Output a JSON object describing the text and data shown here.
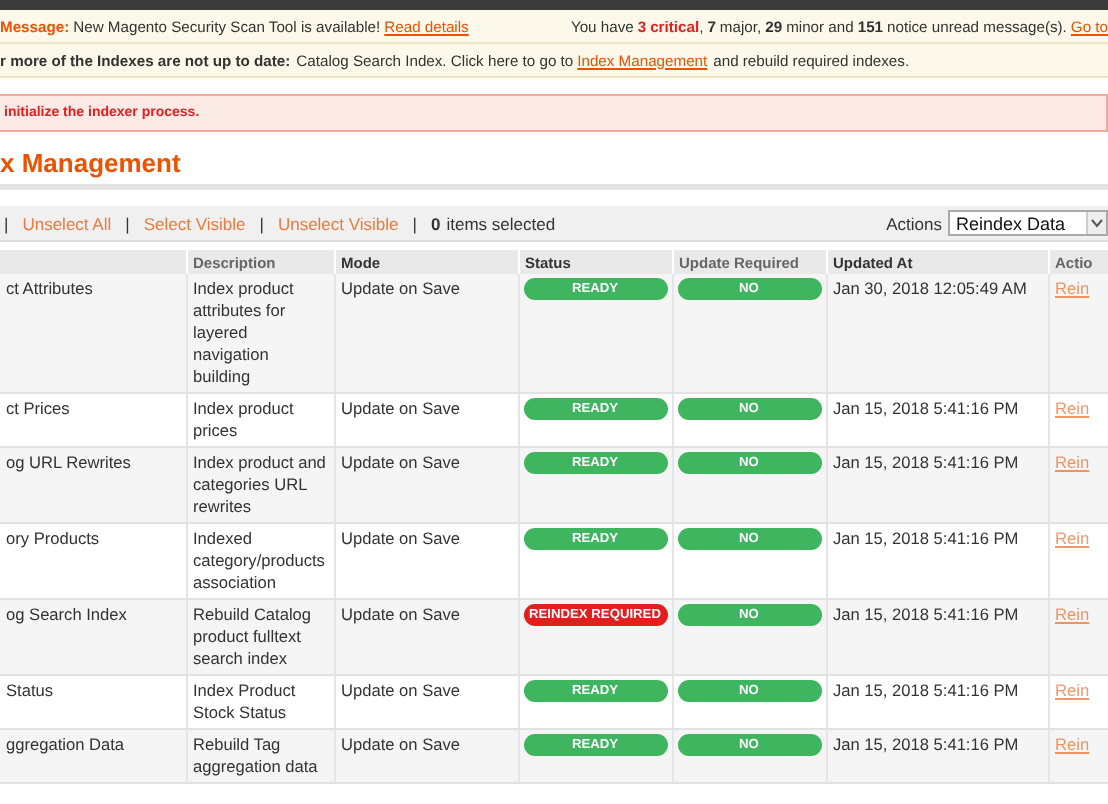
{
  "messages": {
    "system": {
      "label": "Message:",
      "text": "New Magento Security Scan Tool is available!",
      "link": "Read details"
    },
    "counts": {
      "prefix": "You have",
      "critical": "3",
      "critical_label": "critical",
      "critical_separator": ",",
      "major": "7",
      "major_label": "major,",
      "minor": "29",
      "minor_label": "minor and",
      "notice": "151",
      "notice_label": "notice unread message(s).",
      "link": "Go to"
    },
    "index_notice": {
      "label": "r more of the Indexes are not up to date:",
      "text": "Catalog Search Index. Click here to go to",
      "link": "Index Management",
      "suffix": "and rebuild required indexes."
    }
  },
  "error": "initialize the indexer process.",
  "page_title": "x Management",
  "toolbar": {
    "separator": "|",
    "links": [
      "Unselect All",
      "Select Visible",
      "Unselect Visible"
    ],
    "count": "0",
    "count_label": "items selected",
    "actions_label": "Actions",
    "actions_value": "Reindex Data"
  },
  "table": {
    "columns": [
      "",
      "Description",
      "Mode",
      "Status",
      "Update Required",
      "Updated At",
      "Actio"
    ],
    "rows": [
      {
        "name": "ct Attributes",
        "description": "Index product attributes for layered navigation building",
        "mode": "Update on Save",
        "status": {
          "kind": "ready",
          "label": "READY"
        },
        "update_required": "NO",
        "updated_at": "Jan 30, 2018 12:05:49 AM",
        "action": "Rein"
      },
      {
        "name": "ct Prices",
        "description": "Index product prices",
        "mode": "Update on Save",
        "status": {
          "kind": "ready",
          "label": "READY"
        },
        "update_required": "NO",
        "updated_at": "Jan 15, 2018 5:41:16 PM",
        "action": "Rein"
      },
      {
        "name": "og URL Rewrites",
        "description": "Index product and categories URL rewrites",
        "mode": "Update on Save",
        "status": {
          "kind": "ready",
          "label": "READY"
        },
        "update_required": "NO",
        "updated_at": "Jan 15, 2018 5:41:16 PM",
        "action": "Rein"
      },
      {
        "name": "ory Products",
        "description": "Indexed category/products association",
        "mode": "Update on Save",
        "status": {
          "kind": "ready",
          "label": "READY"
        },
        "update_required": "NO",
        "updated_at": "Jan 15, 2018 5:41:16 PM",
        "action": "Rein"
      },
      {
        "name": "og Search Index",
        "description": "Rebuild Catalog product fulltext search index",
        "mode": "Update on Save",
        "status": {
          "kind": "required",
          "label": "REINDEX REQUIRED"
        },
        "update_required": "NO",
        "updated_at": "Jan 15, 2018 5:41:16 PM",
        "action": "Rein"
      },
      {
        "name": "Status",
        "description": "Index Product Stock Status",
        "mode": "Update on Save",
        "status": {
          "kind": "ready",
          "label": "READY"
        },
        "update_required": "NO",
        "updated_at": "Jan 15, 2018 5:41:16 PM",
        "action": "Rein"
      },
      {
        "name": "ggregation Data",
        "description": "Rebuild Tag aggregation data",
        "mode": "Update on Save",
        "status": {
          "kind": "ready",
          "label": "READY"
        },
        "update_required": "NO",
        "updated_at": "Jan 15, 2018 5:41:16 PM",
        "action": "Rein"
      }
    ]
  }
}
